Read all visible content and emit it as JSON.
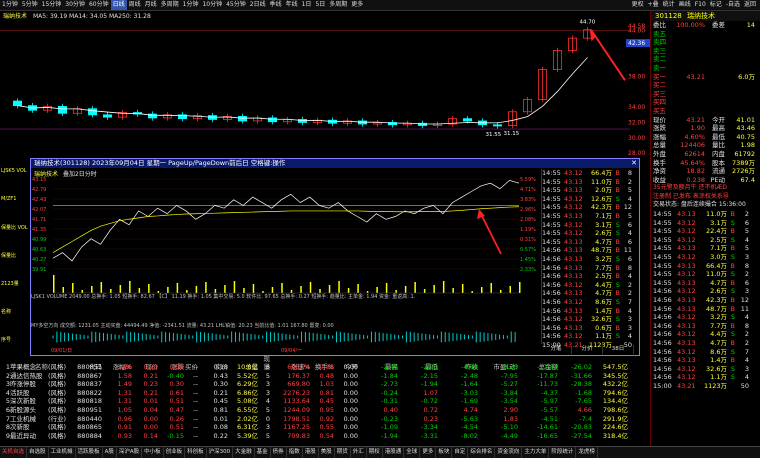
{
  "menubar": {
    "items": [
      "1分钟",
      "5分钟",
      "15分钟",
      "30分钟",
      "60分钟",
      "日线",
      "周线",
      "月线",
      "多周期",
      "1分钟",
      "10分钟",
      "45分钟",
      "2日线",
      "季线",
      "年线",
      "1日",
      "5日",
      "多周期",
      "更多"
    ],
    "active_index": 5,
    "right_items": [
      "更权",
      "+叠",
      "统计",
      "画线",
      "F10",
      "标记",
      "-自选",
      "返回"
    ]
  },
  "main_chart": {
    "stock_label": "瑞纳技术",
    "indicator_line": "MA5: 39.19 MA14: 34.05 MA250: 31.28",
    "price_labels": [
      "44.58",
      "44.00",
      "42.36",
      "38.00",
      "34.00",
      "32.00",
      "30.00",
      "28.00"
    ],
    "high_label": "44.70",
    "low_label": "31.55",
    "low2_label": "31.15",
    "candles": [
      {
        "o": 34.8,
        "c": 34.2
      },
      {
        "o": 34.2,
        "c": 33.6
      },
      {
        "o": 33.6,
        "c": 34.1
      },
      {
        "o": 34.1,
        "c": 33.2
      },
      {
        "o": 33.2,
        "c": 33.8
      },
      {
        "o": 33.8,
        "c": 33.0
      },
      {
        "o": 33.0,
        "c": 32.7
      },
      {
        "o": 32.7,
        "c": 33.3
      },
      {
        "o": 33.3,
        "c": 33.1
      },
      {
        "o": 33.1,
        "c": 32.6
      },
      {
        "o": 32.6,
        "c": 33.0
      },
      {
        "o": 33.0,
        "c": 32.5
      },
      {
        "o": 32.5,
        "c": 32.9
      },
      {
        "o": 32.9,
        "c": 32.4
      },
      {
        "o": 32.4,
        "c": 32.8
      },
      {
        "o": 32.8,
        "c": 32.2
      },
      {
        "o": 32.2,
        "c": 32.6
      },
      {
        "o": 32.6,
        "c": 32.1
      },
      {
        "o": 32.1,
        "c": 32.4
      },
      {
        "o": 32.4,
        "c": 32.0
      },
      {
        "o": 32.0,
        "c": 32.3
      },
      {
        "o": 32.3,
        "c": 31.9
      },
      {
        "o": 31.9,
        "c": 32.2
      },
      {
        "o": 32.2,
        "c": 31.8
      },
      {
        "o": 31.8,
        "c": 32.0
      },
      {
        "o": 32.0,
        "c": 31.7
      },
      {
        "o": 31.7,
        "c": 31.9
      },
      {
        "o": 31.9,
        "c": 31.6
      },
      {
        "o": 31.6,
        "c": 31.8
      },
      {
        "o": 31.8,
        "c": 32.5
      },
      {
        "o": 32.5,
        "c": 32.2
      },
      {
        "o": 32.2,
        "c": 31.7
      },
      {
        "o": 31.7,
        "c": 31.55
      },
      {
        "o": 31.6,
        "c": 33.4
      },
      {
        "o": 33.4,
        "c": 35.0
      },
      {
        "o": 35.0,
        "c": 38.9
      },
      {
        "o": 38.9,
        "c": 41.4
      },
      {
        "o": 41.4,
        "c": 43.0
      },
      {
        "o": 43.0,
        "c": 44.1
      }
    ]
  },
  "popup": {
    "title": "瑞纳技术(301128) 2023年09月04日 星期一 PageUp/PageDown前后日 空格键:操作",
    "sub_label": "瑞纳技术",
    "sub_label2": "叠加2日分时",
    "left_prices": [
      "43.15",
      "42.79",
      "42.43",
      "42.07",
      "41.71",
      "41.35",
      "40.99",
      "40.63",
      "40.27",
      "39.91"
    ],
    "right_pcts": [
      "5.59%",
      "4.71%",
      "3.83%",
      "2.96%",
      "2.08%",
      "1.19%",
      "0.31%",
      "0.57%",
      "1.45%",
      "2.33%"
    ],
    "vol_label": "VOLUME: 2049.00",
    "vol_info": "LJSK1 VOLUME 2049.00 总换手: 1.05 短换手: 82.67 【C】 11.19 换手: 1.05 集中交易: 5.0 软件比: 97.65 总换手: 0.27 短换手: 趋量比: 主单金: 1.94 资金: 重返高: 1.",
    "flow_info": "MY多空方向 成交额: 1231.05 主动买盘: 44494.49 净值: -2341.51 流量: 43.21 LHL铂值: 20.23 当前比值: 1.01 167.80 置变: 0.00",
    "date_left": "09/01/日",
    "date_right": "09/04/一",
    "price_line": [
      40.3,
      40.5,
      40.2,
      40.7,
      41.0,
      40.8,
      41.3,
      41.7,
      41.5,
      42.0,
      41.8,
      42.1,
      41.9,
      42.2,
      42.0,
      41.7,
      41.9,
      42.2,
      42.1,
      42.4,
      42.2,
      42.5,
      42.3,
      42.1,
      42.4,
      42.6,
      42.3,
      42.5,
      42.2,
      42.1,
      42.3,
      42.0,
      41.8,
      41.6,
      41.9,
      41.7,
      41.8,
      42.0,
      41.9,
      42.1,
      42.2,
      41.9,
      42.3,
      42.5,
      42.7,
      42.9,
      43.0,
      42.8,
      43.1,
      43.0
    ],
    "avg_line": [
      40.5,
      40.7,
      40.9,
      41.1,
      41.3,
      41.45,
      41.55,
      41.65,
      41.7,
      41.75,
      41.8,
      41.82,
      41.85,
      41.87,
      41.89,
      41.9,
      41.91,
      41.92,
      41.93,
      41.94,
      41.95,
      41.96,
      41.97,
      41.98,
      41.99,
      42.0,
      42.0,
      42.0,
      42.0,
      42.0,
      42.0,
      42.0,
      42.0,
      41.99,
      41.98,
      41.98,
      41.97,
      41.97,
      41.97,
      41.98,
      41.98,
      41.98,
      42.0,
      42.02,
      42.05,
      42.08,
      42.1,
      42.12,
      42.14,
      42.15
    ]
  },
  "ticks": {
    "rows": [
      {
        "t": "14:55",
        "p": "43.12",
        "v": "66.4万",
        "n": "8",
        "s": "B"
      },
      {
        "t": "14:55",
        "p": "43.13",
        "v": "11.0万",
        "n": "2",
        "s": "B"
      },
      {
        "t": "14:55",
        "p": "43.13",
        "v": "2.0万",
        "n": "5",
        "s": "B"
      },
      {
        "t": "14:55",
        "p": "43.12",
        "v": "12.6万",
        "n": "4",
        "s": "S"
      },
      {
        "t": "14:55",
        "p": "43.12",
        "v": "42.3万",
        "n": "12",
        "s": "B"
      },
      {
        "t": "14:55",
        "p": "43.13",
        "v": "7.1万",
        "n": "5",
        "s": "B"
      },
      {
        "t": "14:55",
        "p": "43.12",
        "v": "3.1万",
        "n": "6",
        "s": "S"
      },
      {
        "t": "14:55",
        "p": "43.12",
        "v": "2.6万",
        "n": "4",
        "s": "S"
      },
      {
        "t": "14:55",
        "p": "43.13",
        "v": "4.7万",
        "n": "6",
        "s": "B"
      },
      {
        "t": "14:56",
        "p": "43.13",
        "v": "48.7万",
        "n": "11",
        "s": "B"
      },
      {
        "t": "14:56",
        "p": "43.13",
        "v": "3.2万",
        "n": "6",
        "s": "S"
      },
      {
        "t": "14:56",
        "p": "43.13",
        "v": "7.7万",
        "n": "8",
        "s": "B"
      },
      {
        "t": "14:56",
        "p": "43.13",
        "v": "2.5万",
        "n": "4",
        "s": "B"
      },
      {
        "t": "14:56",
        "p": "43.12",
        "v": "4.4万",
        "n": "2",
        "s": "S"
      },
      {
        "t": "14:56",
        "p": "43.13",
        "v": "4.7万",
        "n": "2",
        "s": "B"
      },
      {
        "t": "14:56",
        "p": "43.12",
        "v": "8.6万",
        "n": "7",
        "s": "S"
      },
      {
        "t": "14:56",
        "p": "43.13",
        "v": "1.4万",
        "n": "4",
        "s": "B"
      },
      {
        "t": "14:56",
        "p": "43.12",
        "v": "32.6万",
        "n": "3",
        "s": "S"
      },
      {
        "t": "14:56",
        "p": "43.13",
        "v": "0.6万",
        "n": "3",
        "s": "B"
      },
      {
        "t": "14:56",
        "p": "43.12",
        "v": "1.1万",
        "n": "4",
        "s": "S"
      },
      {
        "t": "15:00",
        "p": "43.21",
        "v": "1123万",
        "n": "50",
        "s": ""
      }
    ],
    "bottom_tabs": [
      "分笔",
      "分价",
      "38日"
    ]
  },
  "right_panel": {
    "code": "301128",
    "name": "瑞纳技术",
    "rows": [
      {
        "l": "委比",
        "v1": "100.00%",
        "l2": "委差",
        "v2": "14"
      },
      {
        "l": "卖五",
        "v1": "",
        "l2": "",
        "v2": ""
      },
      {
        "l": "卖四",
        "v1": "",
        "l2": "",
        "v2": ""
      },
      {
        "l": "卖三",
        "v1": "",
        "l2": "",
        "v2": ""
      },
      {
        "l": "卖二",
        "v1": "",
        "l2": "",
        "v2": ""
      },
      {
        "l": "卖一",
        "v1": "",
        "l2": "",
        "v2": ""
      },
      {
        "l": "买一",
        "v1": "43.21",
        "l2": "",
        "v2": "6.0万"
      },
      {
        "l": "买二",
        "v1": "",
        "l2": "",
        "v2": ""
      },
      {
        "l": "买三",
        "v1": "",
        "l2": "",
        "v2": ""
      },
      {
        "l": "买四",
        "v1": "",
        "l2": "",
        "v2": ""
      },
      {
        "l": "买五",
        "v1": "",
        "l2": "",
        "v2": ""
      },
      {
        "l": "现价",
        "v1": "43.21",
        "l2": "今开",
        "v2": "41.01"
      },
      {
        "l": "涨跌",
        "v1": "1.90",
        "l2": "最高",
        "v2": "43.46"
      },
      {
        "l": "涨幅",
        "v1": "4.60%",
        "l2": "最低",
        "v2": "40.75"
      },
      {
        "l": "总量",
        "v1": "124406",
        "l2": "量比",
        "v2": "1.98"
      },
      {
        "l": "外盘",
        "v1": "62614",
        "l2": "内盘",
        "v2": "61792"
      },
      {
        "l": "换手",
        "v1": "45.64%",
        "l2": "股本",
        "v2": "7389万"
      },
      {
        "l": "净资",
        "v1": "18.82",
        "l2": "流通",
        "v2": "2726万"
      },
      {
        "l": "收益",
        "v1": "0.238",
        "l2": "PE动",
        "v2": "67.4"
      }
    ],
    "notice1": "35元警及额月牛 还不机ÆD",
    "notice2": "注册制 已发布 表涂权关系导",
    "notice3": "交易状态: 盘后连续撮合 15:36:00",
    "ticks": [
      {
        "t": "14:55",
        "p": "43.13",
        "v": "11.0万",
        "n": "2",
        "s": "B"
      },
      {
        "t": "14:55",
        "p": "43.12",
        "v": "3.1万",
        "n": "6",
        "s": "S"
      },
      {
        "t": "14:55",
        "p": "43.12",
        "v": "22.4万",
        "n": "5",
        "s": "B"
      },
      {
        "t": "14:55",
        "p": "43.12",
        "v": "2.5万",
        "n": "4",
        "s": "S"
      },
      {
        "t": "14:55",
        "p": "43.13",
        "v": "7.1万",
        "n": "5",
        "s": "B"
      },
      {
        "t": "14:55",
        "p": "43.12",
        "v": "3.0万",
        "n": "3",
        "s": "S"
      },
      {
        "t": "14:55",
        "p": "43.13",
        "v": "66.4万",
        "n": "8",
        "s": "B"
      },
      {
        "t": "14:55",
        "p": "43.12",
        "v": "11.0万",
        "n": "2",
        "s": "S"
      },
      {
        "t": "14:55",
        "p": "43.13",
        "v": "4.7万",
        "n": "6",
        "s": "B"
      },
      {
        "t": "14:56",
        "p": "43.12",
        "v": "2.6万",
        "n": "3",
        "s": "S"
      },
      {
        "t": "14:56",
        "p": "43.13",
        "v": "42.3万",
        "n": "12",
        "s": "B"
      },
      {
        "t": "14:56",
        "p": "43.13",
        "v": "48.7万",
        "n": "11",
        "s": "B"
      },
      {
        "t": "14:56",
        "p": "43.12",
        "v": "3.2万",
        "n": "4",
        "s": "S"
      },
      {
        "t": "14:56",
        "p": "43.13",
        "v": "7.7万",
        "n": "8",
        "s": "B"
      },
      {
        "t": "14:56",
        "p": "43.12",
        "v": "4.4万",
        "n": "2",
        "s": "S"
      },
      {
        "t": "14:56",
        "p": "43.13",
        "v": "4.7万",
        "n": "2",
        "s": "B"
      },
      {
        "t": "14:56",
        "p": "43.12",
        "v": "8.6万",
        "n": "7",
        "s": "S"
      },
      {
        "t": "14:56",
        "p": "43.13",
        "v": "1.4万",
        "n": "4",
        "s": "B"
      },
      {
        "t": "14:56",
        "p": "43.12",
        "v": "32.6万",
        "n": "3",
        "s": "S"
      },
      {
        "t": "14:56",
        "p": "43.12",
        "v": "1.1万",
        "n": "4",
        "s": "S"
      },
      {
        "t": "15:00",
        "p": "43.21",
        "v": "1123万",
        "n": "50",
        "s": ""
      }
    ]
  },
  "left_mini": {
    "labels": [
      "LJSK5 VOL",
      "M/ZF1",
      "保量比 VOL",
      "保量比",
      "2123量",
      "名称",
      "序号"
    ]
  },
  "table": {
    "header": [
      "",
      "名称",
      "",
      "代码",
      "涨幅%",
      "现价",
      "涨跌",
      "买价",
      "卖价",
      "总量",
      "现量",
      "涨速%",
      "换手%",
      "今开",
      "最高",
      "最低",
      "昨收",
      "市盈(动)",
      "总金额"
    ],
    "rows": [
      {
        "i": "1",
        "n": "苹果概念",
        "tag": "(风格)",
        "c": "880851",
        "z": "1.66",
        "p": "0.23",
        "d": "0.58",
        "b": "--",
        "s": "0.18",
        "v": "10.8亿",
        "x": "6",
        "zs": "608.74",
        "h": "0.83",
        "o": "0.00",
        "hi": "-2.46",
        "lo": "-2.93",
        "zc": "-4.68",
        "pe": "-8.23",
        "amt": "-17.84"
      },
      {
        "i": "2",
        "n": "通达信热股",
        "tag": "(风格)",
        "c": "880867",
        "z": "1.58",
        "p": "0.21",
        "d": "-0.40",
        "b": "--",
        "s": "0.43",
        "v": "5.52亿",
        "x": "5",
        "zs": "176.37",
        "h": "0.48",
        "o": "0.00",
        "hi": "-1.84",
        "lo": "-2.15",
        "zc": "-2.48",
        "pe": "-7.95",
        "amt": "-17.87"
      },
      {
        "i": "3",
        "n": "昨涨停股",
        "tag": "(风格)",
        "c": "880837",
        "z": "1.49",
        "p": "0.23",
        "d": "0.30",
        "b": "--",
        "s": "0.30",
        "v": "6.29亿",
        "x": "3",
        "zs": "669.80",
        "h": "1.03",
        "o": "0.00",
        "hi": "-2.73",
        "lo": "-1.94",
        "zc": "-1.64",
        "pe": "-5.27",
        "amt": "-11.73"
      },
      {
        "i": "4",
        "n": "活跃股",
        "tag": "(风格)",
        "c": "880822",
        "z": "1.31",
        "p": "0.21",
        "d": "0.61",
        "b": "--",
        "s": "0.21",
        "v": "6.86亿",
        "x": "3",
        "zs": "2276.23",
        "h": "0.81",
        "o": "0.00",
        "hi": "-0.24",
        "lo": "1.07",
        "zc": "-3.03",
        "pe": "-3.84",
        "amt": "-4.37"
      },
      {
        "i": "5",
        "n": "深次新股",
        "tag": "(风格)",
        "c": "880818",
        "z": "1.31",
        "p": "0.01",
        "d": "0.51",
        "b": "--",
        "s": "0.45",
        "v": "5.08亿",
        "x": "4",
        "zs": "1133.64",
        "h": "0.45",
        "o": "0.00",
        "hi": "-0.31",
        "lo": "-0.72",
        "zc": "-1.69",
        "pe": "-3.54",
        "amt": "-5.97"
      },
      {
        "i": "6",
        "n": "新股源头",
        "tag": "(风格)",
        "c": "880951",
        "z": "1.05",
        "p": "0.04",
        "d": "0.47",
        "b": "--",
        "s": "0.81",
        "v": "6.55亿",
        "x": "5",
        "zs": "1244.09",
        "h": "0.95",
        "o": "0.00",
        "hi": "0.40",
        "lo": "0.72",
        "zc": "4.74",
        "pe": "2.90",
        "amt": "-5.57"
      },
      {
        "i": "7",
        "n": "工业机械",
        "tag": "(行业)",
        "c": "880440",
        "z": "0.96",
        "p": "0.00",
        "d": "0.26",
        "b": "--",
        "s": "0.01",
        "v": "2.02亿",
        "x": "0",
        "zs": "1798.51",
        "h": "0.92",
        "o": "0.00",
        "hi": "-0.23",
        "lo": "0.23",
        "zc": "-5.63",
        "pe": "1.83",
        "amt": "-4.51"
      },
      {
        "i": "8",
        "n": "次新股",
        "tag": "(风格)",
        "c": "880865",
        "z": "0.91",
        "p": "0.00",
        "d": "0.51",
        "b": "--",
        "s": "0.08",
        "v": "6.31亿",
        "x": "3",
        "zs": "1167.25",
        "h": "0.55",
        "o": "0.00",
        "hi": "-1.09",
        "lo": "-3.34",
        "zc": "-4.54",
        "pe": "-5.10",
        "amt": "-14.61"
      },
      {
        "i": "9",
        "n": "最近异动",
        "tag": "(风格)",
        "c": "880884",
        "z": "0.93",
        "p": "0.14",
        "d": "-0.15",
        "b": "--",
        "s": "0.22",
        "v": "5.39亿",
        "x": "5",
        "zs": "709.83",
        "h": "0.54",
        "o": "0.00",
        "hi": "-1.94",
        "lo": "-3.31",
        "zc": "-8.02",
        "pe": "-4.49",
        "amt": "-16.65"
      }
    ],
    "extra_cols": [
      {
        "a": "-26.02",
        "b": "547.5亿"
      },
      {
        "a": "-31.66",
        "b": "345.5亿"
      },
      {
        "a": "-28.38",
        "b": "432.2亿"
      },
      {
        "a": "-1.68",
        "b": "794.6亿"
      },
      {
        "a": "-7.65",
        "b": "134.4亿"
      },
      {
        "a": "4.66",
        "b": "798.6亿"
      },
      {
        "a": "-7.4",
        "b": "291.9亿"
      },
      {
        "a": "-20.83",
        "b": "224.6亿"
      },
      {
        "a": "-27.54",
        "b": "318.4亿"
      }
    ]
  },
  "statusbar": {
    "tabs": [
      "关机自选",
      "自选股",
      "工业机械",
      "活跃股板",
      "A股",
      "深沪A股",
      "中小板",
      "创业板",
      "科创板",
      "沪深300",
      "大金融",
      "基金",
      "债券",
      "指数",
      "港股",
      "美股",
      "期货",
      "外汇",
      "期权",
      "港股通",
      "全球",
      "更多",
      "板块",
      "自定",
      "综合排名",
      "资金流向",
      "主力大单",
      "阶段统计",
      "龙虎榜"
    ]
  }
}
